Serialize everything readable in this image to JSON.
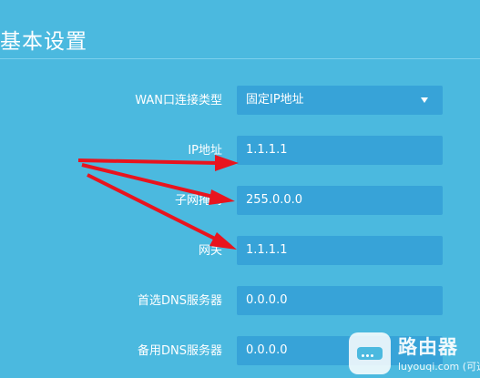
{
  "page_title": "基本设置",
  "form": {
    "wan_type": {
      "label": "WAN口连接类型",
      "value": "固定IP地址"
    },
    "ip": {
      "label": "IP地址",
      "value": "1.1.1.1"
    },
    "subnet": {
      "label": "子网掩码",
      "value": "255.0.0.0"
    },
    "gateway": {
      "label": "网关",
      "value": "1.1.1.1"
    },
    "dns_primary": {
      "label": "首选DNS服务器",
      "value": "0.0.0.0"
    },
    "dns_secondary": {
      "label": "备用DNS服务器",
      "value": "0.0.0.0"
    }
  },
  "watermark": {
    "title": "路由器",
    "url": "luyouqi.com",
    "note": "(可选)"
  },
  "colors": {
    "background": "#4bb9df",
    "field": "#37a3d8",
    "arrow": "#e8141e"
  },
  "icons": {
    "dropdown": "caret-down",
    "watermark_logo": "router-icon",
    "annotation": "red-arrow"
  }
}
